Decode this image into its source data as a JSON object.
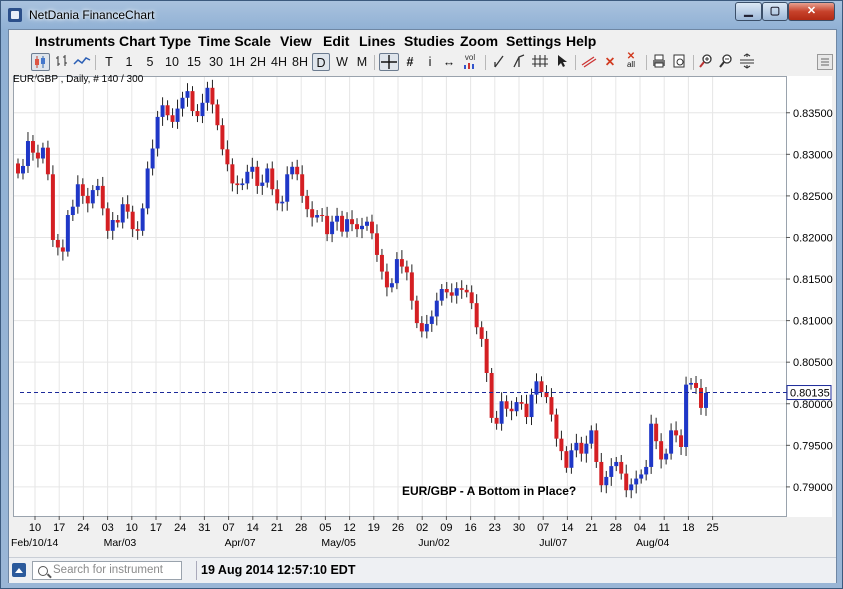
{
  "window": {
    "title": "NetDania FinanceChart",
    "min_glyph": "▁",
    "max_glyph": "▢",
    "close_glyph": "✕"
  },
  "menu": [
    "Instruments",
    "Chart Type",
    "Time Scale",
    "View",
    "Edit",
    "Lines",
    "Studies",
    "Zoom",
    "Settings",
    "Help"
  ],
  "toolbar": {
    "timescales": [
      "T",
      "1",
      "5",
      "10",
      "15",
      "30",
      "1H",
      "2H",
      "4H",
      "8H",
      "D",
      "W",
      "M"
    ],
    "selected_timescale": "D",
    "icons": [
      "candle-style-icon",
      "bar-style-icon",
      "line-style-icon",
      "crosshair-icon",
      "grid-icon",
      "info-icon",
      "pan-icon",
      "volume-icon",
      "trendline-icon",
      "fork-icon",
      "fibonacci-icon",
      "cursor-icon",
      "draw-icon",
      "delete-icon",
      "delete-all-icon",
      "print-icon",
      "print-preview-icon",
      "zoom-in-icon",
      "zoom-out-icon",
      "zoom-fit-icon"
    ],
    "vol_label": "vol",
    "all_label": "all",
    "info_glyph": "i",
    "pan_glyph": "↔",
    "grid_glyph": "#",
    "delete_glyph": "✕"
  },
  "chart": {
    "header": "EUR/GBP , Daily, # 140 / 300",
    "annotation": "EUR/GBP - A Bottom in Place?",
    "price_line_label": "0.80135"
  },
  "chart_data": {
    "type": "candlestick",
    "instrument": "EUR/GBP",
    "timeframe": "Daily",
    "ylim": [
      0.7865,
      0.8393
    ],
    "y_ticks": [
      "0.83500",
      "0.83000",
      "0.82500",
      "0.82000",
      "0.81500",
      "0.81000",
      "0.80500",
      "0.80000",
      "0.79500",
      "0.79000"
    ],
    "x_ticks": [
      "10",
      "17",
      "24",
      "03",
      "10",
      "17",
      "24",
      "31",
      "07",
      "14",
      "21",
      "28",
      "05",
      "12",
      "19",
      "26",
      "02",
      "09",
      "16",
      "23",
      "30",
      "07",
      "14",
      "21",
      "28",
      "04",
      "11",
      "18",
      "25"
    ],
    "x_month_labels": [
      "Feb/10/14",
      "Mar/03",
      "Apr/07",
      "May/05",
      "Jun/02",
      "Jul/07",
      "Aug/04"
    ],
    "current_price": 0.80135,
    "colors": {
      "up": "#1f37c7",
      "down": "#d41f23",
      "price_line": "#1c2a9a",
      "grid": "#e6e6e6"
    },
    "closes": [
      0.8277,
      0.8286,
      0.8316,
      0.8302,
      0.8295,
      0.8308,
      0.8276,
      0.8197,
      0.8188,
      0.8183,
      0.8227,
      0.8237,
      0.8264,
      0.825,
      0.8241,
      0.8257,
      0.8262,
      0.8235,
      0.8208,
      0.8221,
      0.8218,
      0.824,
      0.8231,
      0.821,
      0.8208,
      0.8235,
      0.8283,
      0.8307,
      0.8345,
      0.8359,
      0.8347,
      0.8339,
      0.8355,
      0.8368,
      0.8376,
      0.8352,
      0.8346,
      0.8362,
      0.838,
      0.836,
      0.8335,
      0.8306,
      0.8288,
      0.8265,
      0.8263,
      0.8265,
      0.8279,
      0.8285,
      0.8262,
      0.8266,
      0.8283,
      0.8258,
      0.8241,
      0.8243,
      0.8276,
      0.8285,
      0.8276,
      0.825,
      0.8234,
      0.8224,
      0.8227,
      0.8226,
      0.8204,
      0.8219,
      0.8226,
      0.8207,
      0.8222,
      0.8216,
      0.821,
      0.8214,
      0.8219,
      0.8205,
      0.8179,
      0.8159,
      0.814,
      0.8145,
      0.8174,
      0.8165,
      0.8158,
      0.8124,
      0.8097,
      0.8087,
      0.8096,
      0.8105,
      0.8124,
      0.8138,
      0.8134,
      0.813,
      0.8139,
      0.8137,
      0.8134,
      0.8121,
      0.8092,
      0.8078,
      0.8037,
      0.7983,
      0.7976,
      0.8003,
      0.7994,
      0.7991,
      0.8002,
      0.8,
      0.7984,
      0.8011,
      0.8027,
      0.8014,
      0.8008,
      0.7987,
      0.7958,
      0.7943,
      0.7923,
      0.7944,
      0.7953,
      0.794,
      0.7952,
      0.7968,
      0.793,
      0.7902,
      0.7912,
      0.7925,
      0.793,
      0.7916,
      0.7896,
      0.7903,
      0.791,
      0.7915,
      0.7924,
      0.7976,
      0.7955,
      0.7933,
      0.794,
      0.7968,
      0.7962,
      0.7948,
      0.8023,
      0.8025,
      0.8019,
      0.7995,
      0.8013
    ]
  }
}
